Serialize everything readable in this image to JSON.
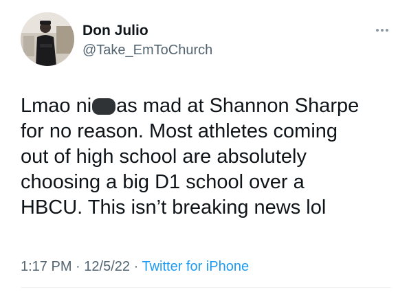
{
  "author": {
    "display_name": "Don Julio",
    "handle": "@Take_EmToChurch",
    "avatar_icon": "profile-photo"
  },
  "tweet": {
    "lines": [
      {
        "before": "Lmao ni",
        "censored": true,
        "after": "as mad at Shannon Sharpe"
      },
      {
        "text": "for no reason. Most athletes coming"
      },
      {
        "text": "out of high school are absolutely"
      },
      {
        "text": "choosing a big D1 school over a"
      },
      {
        "text": "HBCU. This isn’t breaking news lol"
      }
    ]
  },
  "meta": {
    "time": "1:17 PM",
    "separator": "·",
    "date": "12/5/22",
    "source": "Twitter for iPhone"
  },
  "menu": {
    "icon": "more-horizontal-icon"
  },
  "colors": {
    "text": "#0f1419",
    "secondary": "#536471",
    "link": "#1d9bf0",
    "divider": "#eff3f4"
  }
}
